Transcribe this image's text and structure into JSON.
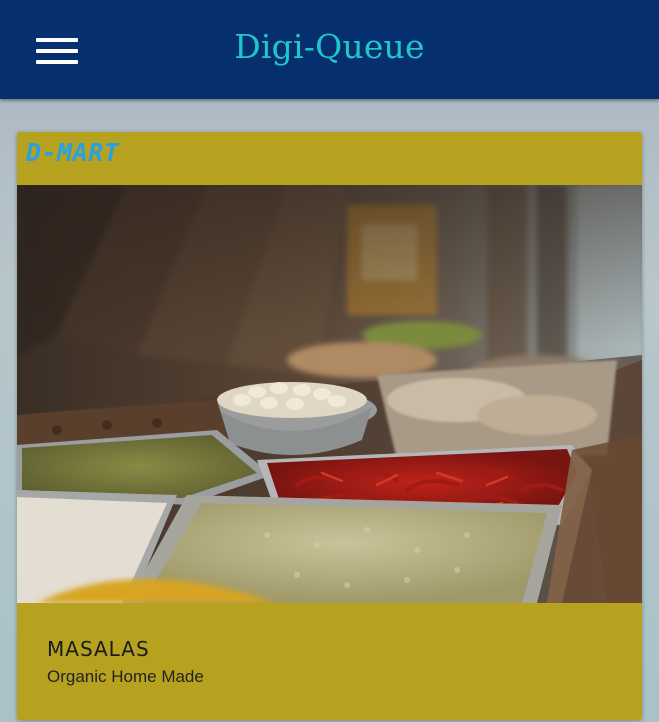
{
  "header": {
    "title": "Digi-Queue",
    "menu_icon": "hamburger-menu-icon",
    "background": "#062f70",
    "title_color": "#22c6c9"
  },
  "card": {
    "store_name": "D-MART",
    "category_title": "MASALAS",
    "category_subtitle": "Organic Home Made",
    "background": "#b7a21f",
    "store_name_color": "#2aa0e0"
  }
}
